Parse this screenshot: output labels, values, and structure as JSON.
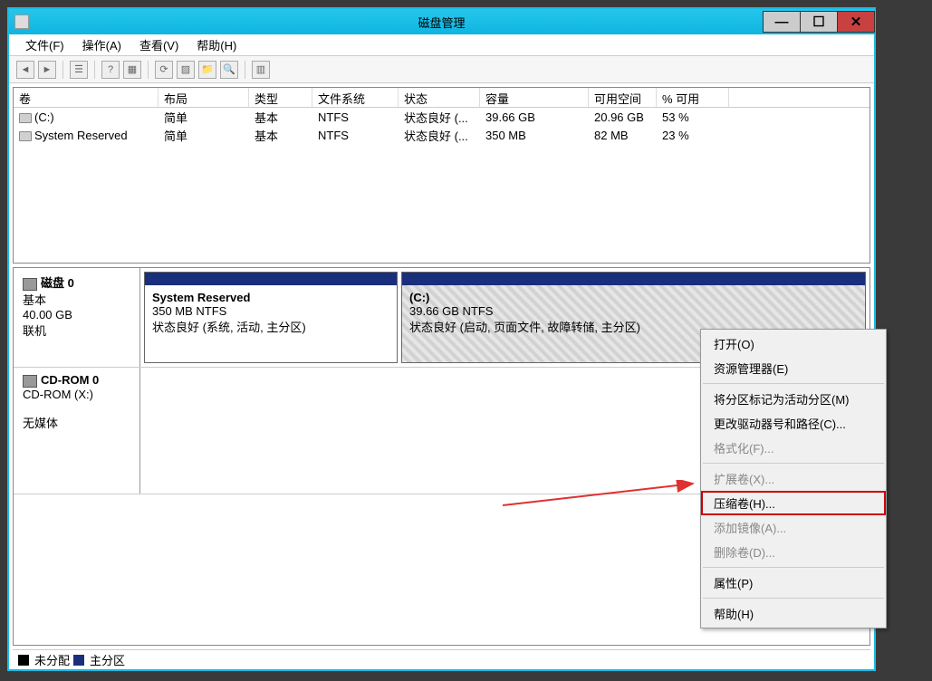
{
  "window": {
    "title": "磁盘管理"
  },
  "menu": {
    "file": "文件(F)",
    "action": "操作(A)",
    "view": "查看(V)",
    "help": "帮助(H)"
  },
  "columns": {
    "volume": "卷",
    "layout": "布局",
    "type": "类型",
    "filesystem": "文件系统",
    "status": "状态",
    "capacity": "容量",
    "freespace": "可用空间",
    "pctfree": "% 可用"
  },
  "volumes": [
    {
      "name": "(C:)",
      "layout": "简单",
      "type": "基本",
      "fs": "NTFS",
      "status": "状态良好 (...",
      "cap": "39.66 GB",
      "free": "20.96 GB",
      "pct": "53 %"
    },
    {
      "name": "System Reserved",
      "layout": "简单",
      "type": "基本",
      "fs": "NTFS",
      "status": "状态良好 (...",
      "cap": "350 MB",
      "free": "82 MB",
      "pct": "23 %"
    }
  ],
  "disk0": {
    "label": "磁盘 0",
    "type": "基本",
    "size": "40.00 GB",
    "state": "联机",
    "part1": {
      "name": "System Reserved",
      "info": "350 MB NTFS",
      "status": "状态良好 (系统, 活动, 主分区)"
    },
    "part2": {
      "name": "(C:)",
      "info": "39.66 GB NTFS",
      "status": "状态良好 (启动, 页面文件, 故障转储, 主分区)"
    }
  },
  "cdrom": {
    "label": "CD-ROM 0",
    "drive": "CD-ROM (X:)",
    "state": "无媒体"
  },
  "legend": {
    "unallocated": "未分配",
    "primary": "主分区"
  },
  "contextmenu": {
    "open": "打开(O)",
    "explorer": "资源管理器(E)",
    "markactive": "将分区标记为活动分区(M)",
    "changeletter": "更改驱动器号和路径(C)...",
    "format": "格式化(F)...",
    "extend": "扩展卷(X)...",
    "shrink": "压缩卷(H)...",
    "addmirror": "添加镜像(A)...",
    "delete": "删除卷(D)...",
    "properties": "属性(P)",
    "help": "帮助(H)"
  }
}
